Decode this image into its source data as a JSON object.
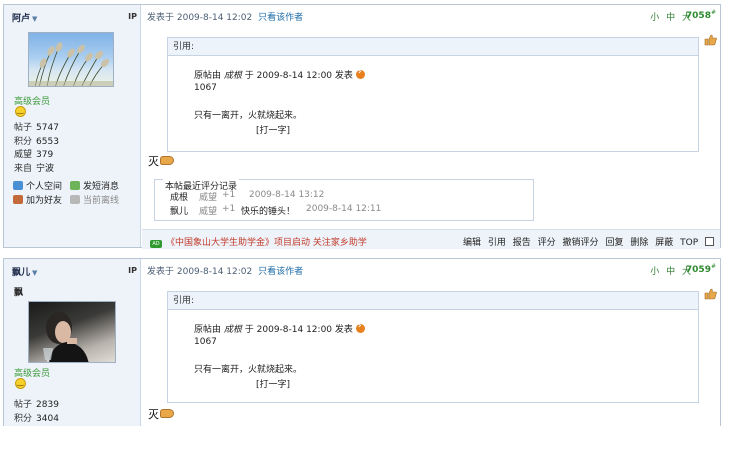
{
  "posts": [
    {
      "username": "阿卢",
      "ip_label": "IP",
      "rank": "高级会员",
      "stats": [
        {
          "label": "帖子",
          "value": "5747"
        },
        {
          "label": "积分",
          "value": "6553"
        },
        {
          "label": "威望",
          "value": "379"
        },
        {
          "label": "来自",
          "value": "宁波"
        }
      ],
      "links": {
        "space": "个人空间",
        "message": "发短消息",
        "friend": "加为好友",
        "status": "当前离线"
      },
      "posted_at": "发表于 2009-8-14 12:02",
      "author_only": "只看该作者",
      "font_sizes": "小 中 大",
      "floor": "7058",
      "floor_mark": "#",
      "quote": {
        "title": "引用:",
        "origin_prefix": "原帖由",
        "origin_author": "成根",
        "origin_time": "于 2009-8-14 12:00 发表",
        "line1": "1067",
        "line2": "只有一离开，火就烧起来。",
        "line3": "[打一字]"
      },
      "reply_text": "灭",
      "ratings": {
        "title": "本帖最近评分记录",
        "rows": [
          {
            "name": "成根",
            "type": "威望",
            "points": "+1",
            "reason": "",
            "time": "2009-8-14 13:12"
          },
          {
            "name": "飘儿",
            "type": "威望",
            "points": "+1",
            "reason": "快乐的锤头！",
            "time": "2009-8-14 12:11"
          }
        ]
      },
      "footer": {
        "ad_icon": "AD",
        "ad_text": "《中国象山大学生助学金》项目启动  关注家乡助学",
        "actions": [
          "编辑",
          "引用",
          "报告",
          "评分",
          "撤销评分",
          "回复",
          "删除",
          "屏蔽",
          "TOP"
        ]
      }
    },
    {
      "username": "飘儿",
      "ip_label": "IP",
      "nickname": "飘",
      "rank": "高级会员",
      "stats": [
        {
          "label": "帖子",
          "value": "2839"
        },
        {
          "label": "积分",
          "value": "3404"
        }
      ],
      "posted_at": "发表于 2009-8-14 12:02",
      "author_only": "只看该作者",
      "font_sizes": "小 中 大",
      "floor": "7059",
      "floor_mark": "#",
      "quote": {
        "title": "引用:",
        "origin_prefix": "原帖由",
        "origin_author": "成根",
        "origin_time": "于 2009-8-14 12:00 发表",
        "line1": "1067",
        "line2": "只有一离开，火就烧起来。",
        "line3": "[打一字]"
      },
      "reply_text": "灭"
    }
  ],
  "colors": {
    "sidebar_bg": "#eef3f9",
    "border": "#b9c6d4",
    "link_blue": "#1d6ca9",
    "rank_green": "#3a9a3a",
    "ad_red": "#c23a2a"
  }
}
